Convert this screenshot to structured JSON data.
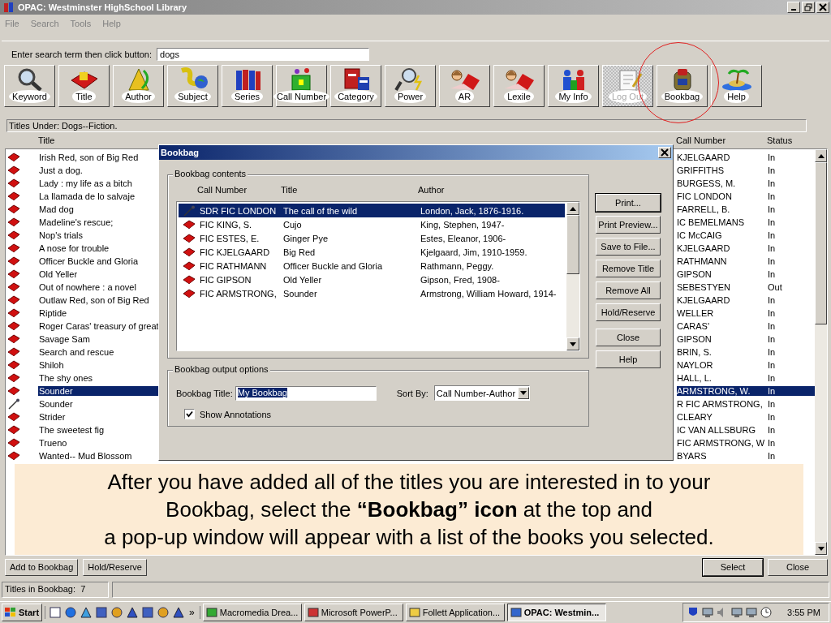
{
  "window": {
    "title": "OPAC: Westminster HighSchool Library"
  },
  "menu": [
    "File",
    "Search",
    "Tools",
    "Help"
  ],
  "search": {
    "label": "Enter search term then click button:",
    "value": "dogs"
  },
  "toolbar": [
    {
      "label": "Keyword",
      "disabled": false
    },
    {
      "label": "Title",
      "disabled": false
    },
    {
      "label": "Author",
      "disabled": false
    },
    {
      "label": "Subject",
      "disabled": false
    },
    {
      "label": "Series",
      "disabled": false
    },
    {
      "label": "Call Number",
      "disabled": false
    },
    {
      "label": "Category",
      "disabled": false
    },
    {
      "label": "Power",
      "disabled": false
    },
    {
      "label": "AR",
      "disabled": false
    },
    {
      "label": "Lexile",
      "disabled": false
    },
    {
      "label": "My Info",
      "disabled": false
    },
    {
      "label": "Log Out",
      "disabled": true
    },
    {
      "label": "Bookbag",
      "disabled": false
    },
    {
      "label": "Help",
      "disabled": false
    }
  ],
  "results": {
    "heading": "Titles Under: Dogs--Fiction.",
    "columns": [
      "Title",
      "Call Number",
      "Status"
    ],
    "rows": [
      {
        "kind": "book",
        "title": "Irish Red, son of Big Red",
        "call_number": "KJELGAARD",
        "status": "In",
        "selected": false
      },
      {
        "kind": "book",
        "title": "Just a dog.",
        "call_number": "GRIFFITHS",
        "status": "In",
        "selected": false
      },
      {
        "kind": "book",
        "title": "Lady : my life as a bitch",
        "call_number": "BURGESS, M.",
        "status": "In",
        "selected": false
      },
      {
        "kind": "book",
        "title": "La llamada de lo salvaje",
        "call_number": "FIC LONDON",
        "status": "In",
        "selected": false
      },
      {
        "kind": "book",
        "title": "Mad dog",
        "call_number": "FARRELL, B.",
        "status": "In",
        "selected": false
      },
      {
        "kind": "book",
        "title": "Madeline's rescue;",
        "call_number": "IC  BEMELMANS",
        "status": "In",
        "selected": false
      },
      {
        "kind": "book",
        "title": "Nop's trials",
        "call_number": "IC McCAIG",
        "status": "In",
        "selected": false
      },
      {
        "kind": "book",
        "title": "A nose for trouble",
        "call_number": "KJELGAARD",
        "status": "In",
        "selected": false
      },
      {
        "kind": "book",
        "title": "Officer Buckle and Gloria",
        "call_number": "RATHMANN",
        "status": "In",
        "selected": false
      },
      {
        "kind": "book",
        "title": "Old Yeller",
        "call_number": "GIPSON",
        "status": "In",
        "selected": false
      },
      {
        "kind": "book",
        "title": "Out of nowhere : a novel",
        "call_number": "SEBESTYEN",
        "status": "Out",
        "selected": false
      },
      {
        "kind": "book",
        "title": "Outlaw Red, son of Big Red",
        "call_number": "KJELGAARD",
        "status": "In",
        "selected": false
      },
      {
        "kind": "book",
        "title": "Riptide",
        "call_number": "WELLER",
        "status": "In",
        "selected": false
      },
      {
        "kind": "book",
        "title": "Roger Caras' treasury of great",
        "call_number": "CARAS'",
        "status": "In",
        "selected": false
      },
      {
        "kind": "book",
        "title": "Savage Sam",
        "call_number": "GIPSON",
        "status": "In",
        "selected": false
      },
      {
        "kind": "book",
        "title": "Search and rescue",
        "call_number": "BRIN, S.",
        "status": "In",
        "selected": false
      },
      {
        "kind": "book",
        "title": "Shiloh",
        "call_number": "NAYLOR",
        "status": "In",
        "selected": false
      },
      {
        "kind": "book",
        "title": "The shy ones",
        "call_number": "HALL, L.",
        "status": "In",
        "selected": false
      },
      {
        "kind": "book",
        "title": "Sounder",
        "call_number": "ARMSTRONG, W.",
        "status": "In",
        "selected": true
      },
      {
        "kind": "recording",
        "title": "Sounder",
        "call_number": "R FIC ARMSTRONG,",
        "status": "In",
        "selected": false
      },
      {
        "kind": "book",
        "title": "Strider",
        "call_number": "CLEARY",
        "status": "In",
        "selected": false
      },
      {
        "kind": "book",
        "title": "The sweetest fig",
        "call_number": "IC VAN ALLSBURG",
        "status": "In",
        "selected": false
      },
      {
        "kind": "book",
        "title": "Trueno",
        "call_number": "FIC ARMSTRONG, W",
        "status": "In",
        "selected": false
      },
      {
        "kind": "book",
        "title": "Wanted-- Mud Blossom",
        "call_number": "BYARS",
        "status": "In",
        "selected": false
      }
    ]
  },
  "bookbag": {
    "title": "Bookbag",
    "contents_label": "Bookbag contents",
    "columns": [
      "Call Number",
      "Title",
      "Author"
    ],
    "rows": [
      {
        "kind": "recording",
        "call_number": "SDR FIC LONDON",
        "title": "The call of the wild",
        "author": "London, Jack, 1876-1916.",
        "selected": true
      },
      {
        "kind": "book",
        "call_number": "FIC KING, S.",
        "title": "Cujo",
        "author": "King, Stephen, 1947-",
        "selected": false
      },
      {
        "kind": "book",
        "call_number": "FIC ESTES, E.",
        "title": "Ginger Pye",
        "author": "Estes, Eleanor, 1906-",
        "selected": false
      },
      {
        "kind": "book",
        "call_number": "FIC KJELGAARD",
        "title": "Big Red",
        "author": "Kjelgaard, Jim, 1910-1959.",
        "selected": false
      },
      {
        "kind": "book",
        "call_number": "FIC RATHMANN",
        "title": "Officer Buckle and Gloria",
        "author": "Rathmann, Peggy.",
        "selected": false
      },
      {
        "kind": "book",
        "call_number": "FIC GIPSON",
        "title": "Old Yeller",
        "author": "Gipson, Fred, 1908-",
        "selected": false
      },
      {
        "kind": "book",
        "call_number": "FIC ARMSTRONG,",
        "title": "Sounder",
        "author": "Armstrong, William Howard, 1914-",
        "selected": false
      }
    ],
    "buttons": [
      "Print...",
      "Print Preview...",
      "Save to File...",
      "Remove Title",
      "Remove All",
      "Hold/Reserve",
      "Close",
      "Help"
    ],
    "output_label": "Bookbag output options",
    "title_field": {
      "label": "Bookbag Title:",
      "value": "My Bookbag"
    },
    "sort": {
      "label": "Sort By:",
      "value": "Call Number-Author"
    },
    "annotations": {
      "label": "Show Annotations",
      "checked": true
    }
  },
  "callout": {
    "lines": [
      "After you have added all of the titles you are interested in to your",
      "Bookbag, select the **“Bookbag” icon** at the top and",
      "a pop-up window will appear with a list of the books you selected."
    ]
  },
  "bottom_buttons_left": [
    "Add to Bookbag",
    "Hold/Reserve"
  ],
  "bottom_buttons_right": [
    "Select",
    "Close"
  ],
  "status_bar": "Titles in Bookbag:  7",
  "taskbar": {
    "start": "Start",
    "chevron": "»",
    "tasks": [
      {
        "label": "Macromedia Drea...",
        "selected": false
      },
      {
        "label": "Microsoft PowerP...",
        "selected": false
      },
      {
        "label": "Follett Application...",
        "selected": false
      },
      {
        "label": "OPAC: Westmin...",
        "selected": true
      }
    ],
    "clock": "3:55 PM"
  }
}
